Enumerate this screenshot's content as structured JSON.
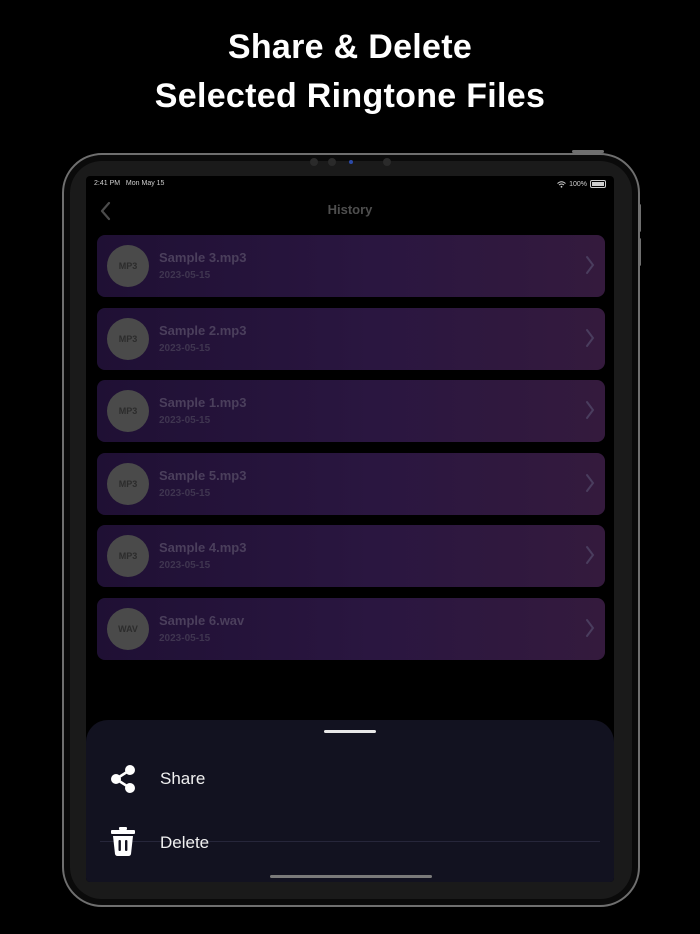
{
  "promo": {
    "line1": "Share & Delete",
    "line2": "Selected Ringtone Files"
  },
  "status_bar": {
    "time": "2:41 PM",
    "date": "Mon May 15",
    "battery": "100%"
  },
  "nav": {
    "back_icon": "chevron-left-icon",
    "title": "History"
  },
  "history": [
    {
      "format": "MP3",
      "name": "Sample 3.mp3",
      "date": "2023-05-15"
    },
    {
      "format": "MP3",
      "name": "Sample 2.mp3",
      "date": "2023-05-15"
    },
    {
      "format": "MP3",
      "name": "Sample 1.mp3",
      "date": "2023-05-15"
    },
    {
      "format": "MP3",
      "name": "Sample 5.mp3",
      "date": "2023-05-15"
    },
    {
      "format": "MP3",
      "name": "Sample 4.mp3",
      "date": "2023-05-15"
    },
    {
      "format": "WAV",
      "name": "Sample 6.wav",
      "date": "2023-05-15"
    }
  ],
  "action_sheet": {
    "share_label": "Share",
    "share_icon": "share-icon",
    "delete_label": "Delete",
    "delete_icon": "trash-icon"
  },
  "colors": {
    "background": "#000000",
    "sheet": "#121220",
    "row_gradient_start": "#1f1034",
    "row_gradient_end": "#341a3d"
  }
}
